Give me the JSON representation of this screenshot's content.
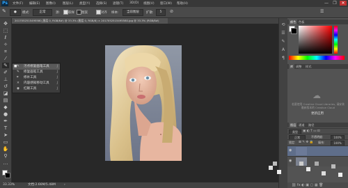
{
  "app": {
    "logo": "Ps"
  },
  "menubar": {
    "items": [
      {
        "label": "文件(F)"
      },
      {
        "label": "编辑(E)"
      },
      {
        "label": "图像(I)"
      },
      {
        "label": "图层(L)"
      },
      {
        "label": "类型(Y)"
      },
      {
        "label": "选择(S)"
      },
      {
        "label": "滤镜(T)"
      },
      {
        "label": "3D(D)"
      },
      {
        "label": "视图(V)"
      },
      {
        "label": "窗口(W)"
      },
      {
        "label": "帮助(H)"
      }
    ],
    "window_controls": {
      "minimize": "—",
      "restore": "❐",
      "close": "✕"
    }
  },
  "options": {
    "mode_label": "模式:",
    "mode_value": "正常",
    "source_label": "源:",
    "sampled_button": "取样",
    "pattern_button": "图案",
    "aligned_label": "对齐",
    "sample_label": "样本:",
    "sample_value": "当前图层",
    "diffusion_label": "扩散:",
    "diffusion_value": "5"
  },
  "document": {
    "tab_title": "2017052515495580_图层 0, RGB/8#) @ 33.3% (图层 0, RGB/8) × 2017052515495580.jpg @ 33.3% (RGB/8#)"
  },
  "tool_flyout": {
    "items": [
      {
        "marker": "■",
        "icon": "✎",
        "label": "污点修复画笔工具",
        "key": "J"
      },
      {
        "marker": "",
        "icon": "✎",
        "label": "修复画笔工具",
        "key": "J"
      },
      {
        "marker": "",
        "icon": "⌗",
        "label": "修补工具",
        "key": "J"
      },
      {
        "marker": "",
        "icon": "✕",
        "label": "内容感知移动工具",
        "key": "J"
      },
      {
        "marker": "",
        "icon": "◉",
        "label": "红眼工具",
        "key": "J"
      }
    ]
  },
  "statusbar": {
    "zoom": "33.33%",
    "doc_size": "文档:2.66M/5.48M",
    "arrow": "›"
  },
  "panels": {
    "color_tabs": [
      "颜色",
      "色板"
    ],
    "library_tabs": [
      "库",
      "调整",
      "样式"
    ],
    "cc_text": "若要使用 Creative Cloud Libraries, 请安装最新版本的 Creative Cloud",
    "cc_button": "更新应用",
    "layers_tabs": [
      "图层",
      "通道",
      "路径"
    ],
    "kind_label": "类型",
    "blend_value": "正常",
    "opacity_label": "不透明度:",
    "opacity_value": "100%",
    "lock_label": "锁定:",
    "fill_label": "填充:",
    "fill_value": "100%"
  },
  "colors": {
    "foreground": "#ffffff",
    "background": "#000000",
    "selection": "#5f6e8a"
  }
}
